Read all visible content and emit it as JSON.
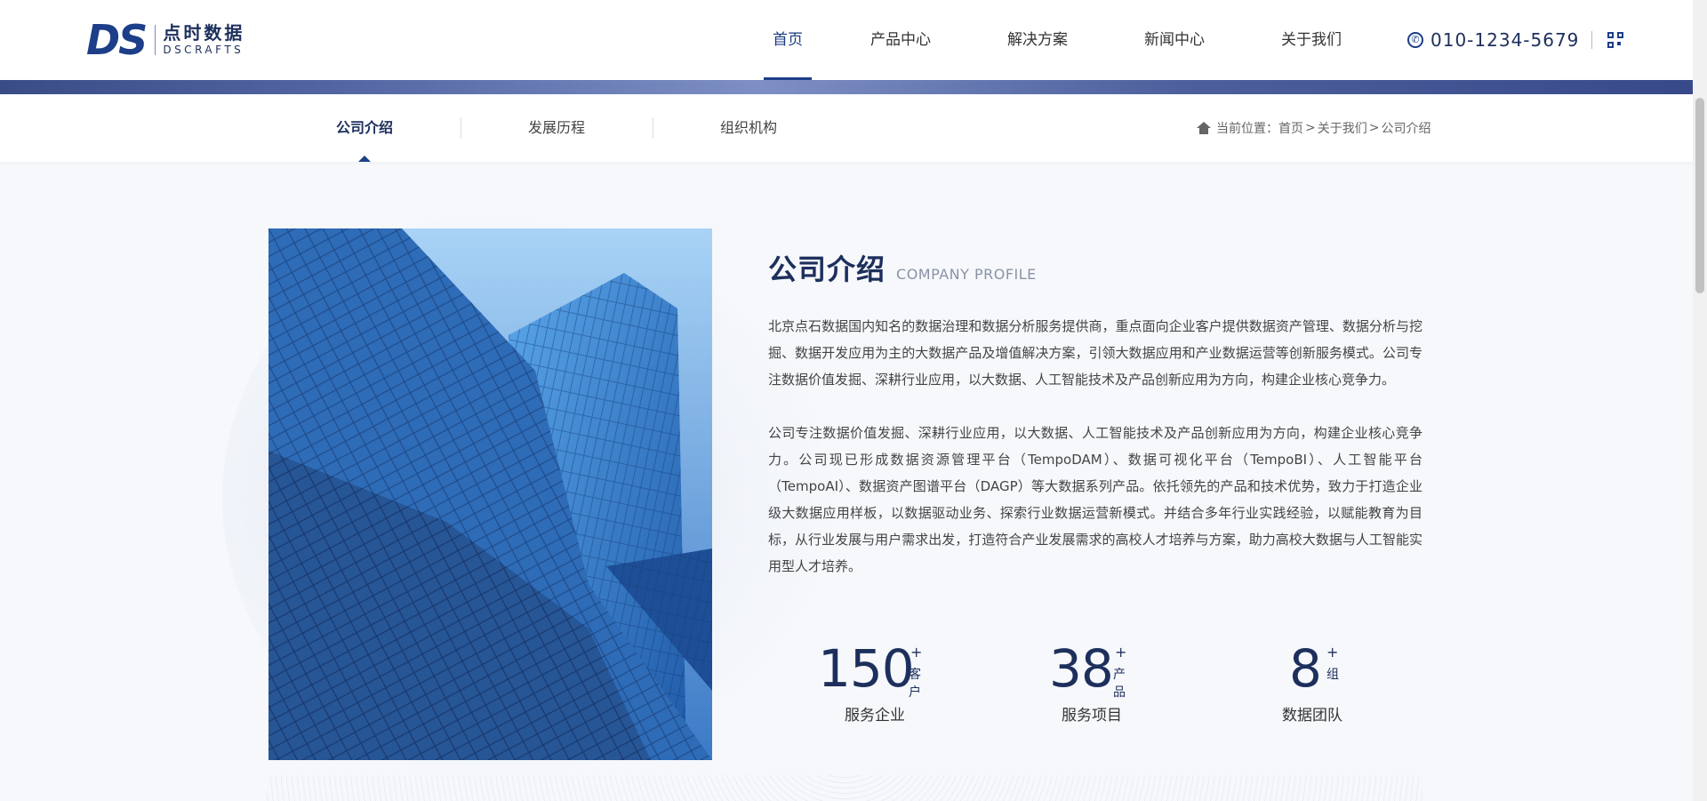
{
  "header": {
    "logo": {
      "mark": "DS",
      "cn": "点时数据",
      "en": "DSCRAFTS"
    },
    "nav": [
      {
        "label": "首页",
        "active": true
      },
      {
        "label": "产品中心",
        "active": false
      },
      {
        "label": "解决方案",
        "active": false
      },
      {
        "label": "新闻中心",
        "active": false
      },
      {
        "label": "关于我们",
        "active": false
      }
    ],
    "phone": "010-1234-5679",
    "phone_icon": "phone-icon",
    "qr_icon": "qr-code-icon"
  },
  "subnav": {
    "items": [
      {
        "label": "公司介绍",
        "active": true
      },
      {
        "label": "发展历程",
        "active": false
      },
      {
        "label": "组织机构",
        "active": false
      }
    ],
    "breadcrumb": {
      "prefix": "当前位置：",
      "items": [
        "首页",
        "关于我们",
        "公司介绍"
      ],
      "separator": ">"
    }
  },
  "about": {
    "title_cn": "公司介绍",
    "title_en": "COMPANY PROFILE",
    "paragraphs": [
      "北京点石数据国内知名的数据治理和数据分析服务提供商，重点面向企业客户提供数据资产管理、数据分析与挖掘、数据开发应用为主的大数据产品及增值解决方案，引领大数据应用和产业数据运营等创新服务模式。公司专注数据价值发掘、深耕行业应用，以大数据、人工智能技术及产品创新应用为方向，构建企业核心竞争力。",
      "公司专注数据价值发掘、深耕行业应用，以大数据、人工智能技术及产品创新应用为方向，构建企业核心竞争力。公司现已形成数据资源管理平台（TempoDAM）、数据可视化平台（TempoBI）、人工智能平台（TempoAI）、数据资产图谱平台（DAGP）等大数据系列产品。依托领先的产品和技术优势，致力于打造企业级大数据应用样板，以数据驱动业务、探索行业数据运营新模式。并结合多年行业实践经验，以赋能教育为目标，从行业发展与用户需求出发，打造符合产业发展需求的高校人才培养与方案，助力高校大数据与人工智能实用型人才培养。"
    ]
  },
  "stats": [
    {
      "num": "150",
      "plus": "+",
      "unit": "客户",
      "label": "服务企业"
    },
    {
      "num": "38",
      "plus": "+",
      "unit": "产品",
      "label": "服务项目"
    },
    {
      "num": "8",
      "plus": "+",
      "unit": "组",
      "label": "数据团队"
    }
  ],
  "colors": {
    "brand": "#1d3e88",
    "title": "#1d2f5c",
    "background": "#f6f8fb"
  }
}
